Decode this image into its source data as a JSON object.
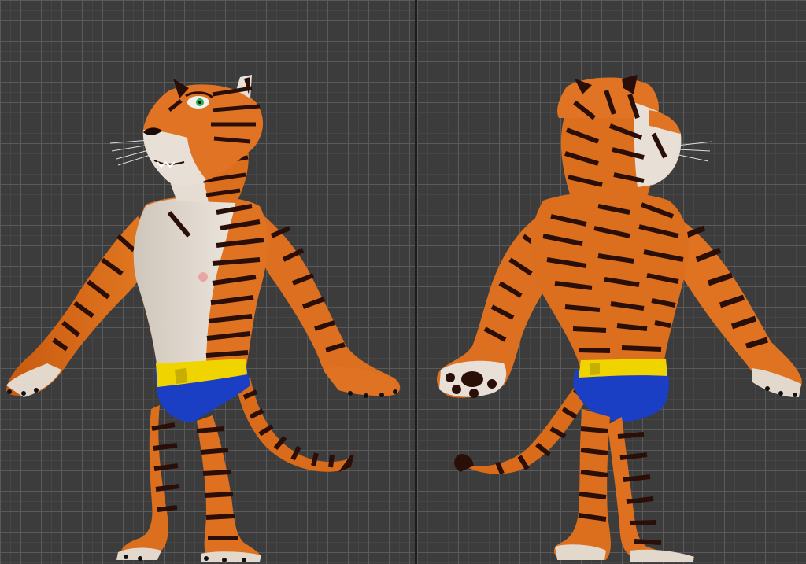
{
  "viewports": [
    {
      "view": "front-three-quarter",
      "label": ""
    },
    {
      "view": "back-three-quarter",
      "label": ""
    }
  ],
  "colors": {
    "viewport_bg": "#3c3c3c",
    "grid_line": "#5a5a5a",
    "divider": "#1c1c1c",
    "fur_orange": "#d86a18",
    "fur_light": "#e4dcd2",
    "stripe": "#2a0f08",
    "shorts_blue": "#1a3fc4",
    "waistband_yellow": "#f0d400"
  }
}
